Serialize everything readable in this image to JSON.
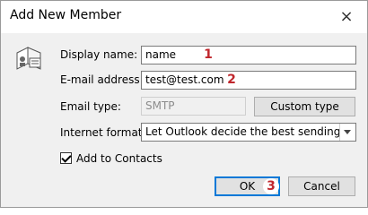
{
  "window": {
    "title": "Add New Member",
    "close_label": "×"
  },
  "form": {
    "display_name_label": "Display name:",
    "display_name_value": "name",
    "email_label": "E-mail address:",
    "email_value": "test@test.com",
    "email_type_label": "Email type:",
    "email_type_value": "SMTP",
    "custom_type_label": "Custom type",
    "internet_format_label": "Internet format:",
    "internet_format_value": "Let Outlook decide the best sending format",
    "add_to_contacts_label": "Add to Contacts",
    "add_to_contacts_checked": true
  },
  "buttons": {
    "ok_label": "OK",
    "cancel_label": "Cancel"
  },
  "annotations": {
    "step1": "1",
    "step2": "2",
    "step3": "3"
  },
  "icons": {
    "dialog_icon": "contact-card-icon",
    "dropdown": "chevron-down-icon",
    "checkmark": "checkmark-icon"
  },
  "colors": {
    "annotation_badge": "#c0262c",
    "default_button_border": "#0078d7"
  }
}
